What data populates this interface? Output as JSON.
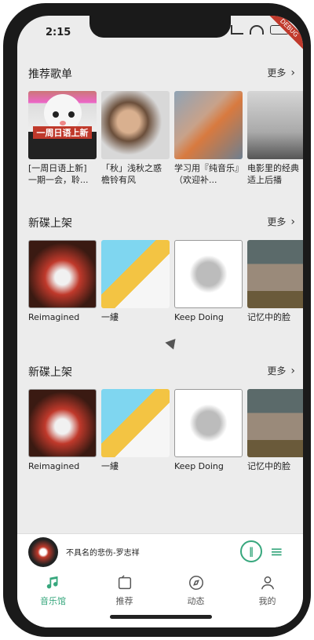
{
  "status": {
    "time": "2:15"
  },
  "debug_label": "DEBUG",
  "sections": [
    {
      "title": "推荐歌单",
      "more": "更多",
      "items": [
        {
          "caption": "[一周日语上新] 一期一会，聆...",
          "tag": "一周日语上新"
        },
        {
          "caption": "「秋」浅秋之惑 檐铃有风"
        },
        {
          "caption": "学习用『纯音乐』（欢迎补..."
        },
        {
          "caption": "电影里的经典 白适上后播"
        }
      ]
    },
    {
      "title": "新碟上架",
      "more": "更多",
      "items": [
        {
          "caption": "Reimagined"
        },
        {
          "caption": "一縷"
        },
        {
          "caption": "Keep Doing"
        },
        {
          "caption": "记忆中的脸"
        }
      ]
    },
    {
      "title": "新碟上架",
      "more": "更多",
      "items": [
        {
          "caption": "Reimagined"
        },
        {
          "caption": "一縷"
        },
        {
          "caption": "Keep Doing"
        },
        {
          "caption": "记忆中的脸"
        }
      ]
    }
  ],
  "player": {
    "song": "不具名的悲伤-罗志祥"
  },
  "tabs": [
    {
      "label": "音乐馆",
      "icon": "music-note-icon",
      "active": true
    },
    {
      "label": "推荐",
      "icon": "radio-icon",
      "active": false
    },
    {
      "label": "动态",
      "icon": "compass-icon",
      "active": false
    },
    {
      "label": "我的",
      "icon": "profile-icon",
      "active": false
    }
  ],
  "colors": {
    "accent": "#37a77d",
    "background": "#ececec"
  }
}
